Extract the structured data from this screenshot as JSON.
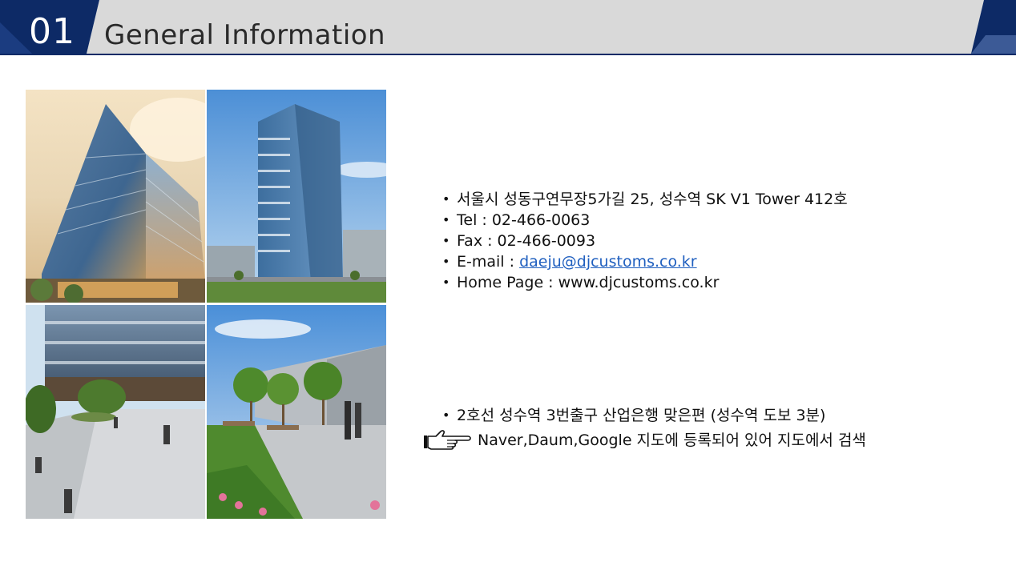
{
  "header": {
    "section_number": "01",
    "title": "General Information",
    "colors": {
      "navy": "#0d2a66",
      "band": "#d9d9d9",
      "rule": "#0d2a66"
    }
  },
  "photos": [
    {
      "icon": "building-photo",
      "subject": "tower-low-angle"
    },
    {
      "icon": "building-photo",
      "subject": "tower-street-view"
    },
    {
      "icon": "plaza-photo",
      "subject": "ground-plaza"
    },
    {
      "icon": "garden-photo",
      "subject": "rooftop-garden"
    }
  ],
  "contact": {
    "address": "서울시 성동구연무장5가길 25, 성수역 SK V1 Tower 412호",
    "tel": "Tel : 02-466-0063",
    "fax": "Fax : 02-466-0093",
    "email_label": "E-mail : ",
    "email": "daeju@djcustoms.co.kr",
    "homepage": "Home Page : www.djcustoms.co.kr",
    "link_color": "#1f5fbf"
  },
  "directions": {
    "subway": "2호선 성수역 3번출구 산업은행 맞은편 (성수역 도보 3분)",
    "map_note": "Naver,Daum,Google 지도에 등록되어 있어 지도에서 검색",
    "map_note_icon": "pointing-hand-icon"
  }
}
